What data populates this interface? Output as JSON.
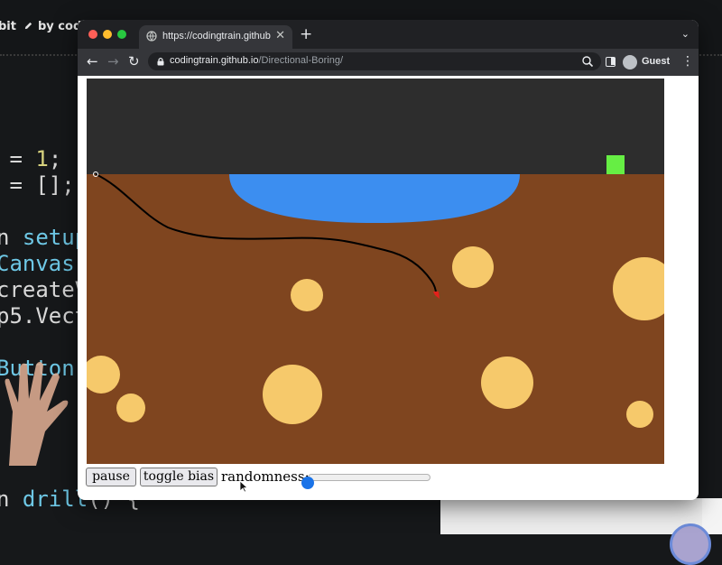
{
  "editor": {
    "crumb_left": "bit",
    "crumb_right": "by codin",
    "code_lines": [
      {
        "pre": "",
        "fn": "",
        "rest": " = ",
        "num": "1",
        "tail": ";"
      },
      {
        "pre": "",
        "fn": "",
        "rest": " = [];",
        "num": "",
        "tail": ""
      },
      {
        "pre": "",
        "fn": "",
        "rest": "",
        "num": "",
        "tail": ""
      },
      {
        "pre": "",
        "fn": "",
        "rest": "n ",
        "num": "",
        "tail": "",
        "fn2": "setup"
      },
      {
        "pre": "",
        "fn": "Canvas",
        "rest": "",
        "num": "",
        "tail": ""
      },
      {
        "pre": "",
        "fn": "",
        "rest": "createV",
        "num": "",
        "tail": ""
      },
      {
        "pre": "",
        "fn": "",
        "rest": "p5.Vect",
        "num": "",
        "tail": ""
      },
      {
        "pre": "",
        "fn": "",
        "rest": "",
        "num": "",
        "tail": ""
      },
      {
        "pre": "",
        "fn": "Button",
        "rest": "",
        "num": "",
        "tail": ""
      },
      {
        "pre": "",
        "fn": "",
        "rest": "",
        "num": "",
        "tail": ""
      },
      {
        "pre": "",
        "fn": "",
        "rest": "",
        "num": "",
        "tail": ""
      },
      {
        "pre": "",
        "fn": "",
        "rest": "",
        "num": "",
        "tail": ""
      },
      {
        "pre": "",
        "fn": "",
        "rest": "",
        "num": "",
        "tail": ""
      },
      {
        "pre": "",
        "fn": "",
        "rest": "n ",
        "num": "",
        "tail": "",
        "fn2": "drill",
        "after": "() {"
      }
    ]
  },
  "browser": {
    "tab_title": "https://codingtrain.github.io/Di",
    "url_host": "codingtrain.github.io",
    "url_path": "/Directional-Boring/",
    "profile_label": "Guest"
  },
  "controls": {
    "pause_label": "pause",
    "toggle_bias_label": "toggle bias",
    "randomness_label": "randomness:",
    "randomness_value": 0
  },
  "sketch": {
    "colors": {
      "sky": "#2d2d2d",
      "dirt": "#7f451f",
      "water": "#3c8ef0",
      "boulder": "#f6c96b",
      "goal": "#66ee44",
      "drill_path": "#000000"
    }
  },
  "colors": {
    "tab_bar": "#202124",
    "toolbar": "#35363a",
    "slider_accent": "#1a73e8"
  }
}
